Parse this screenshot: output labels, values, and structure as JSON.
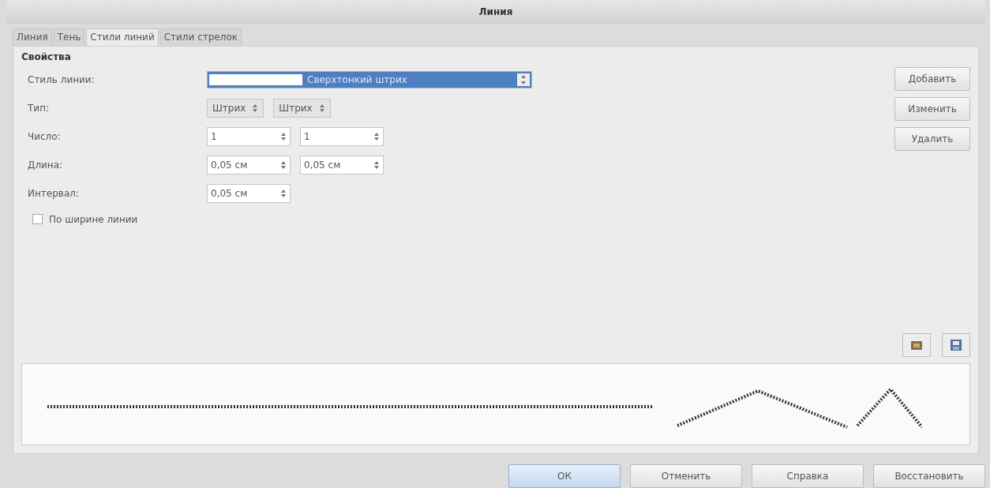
{
  "window": {
    "title": "Линия"
  },
  "tabs": [
    {
      "label": "Линия",
      "selected": false
    },
    {
      "label": "Тень",
      "selected": false
    },
    {
      "label": "Стили линий",
      "selected": true
    },
    {
      "label": "Стили стрелок",
      "selected": false
    }
  ],
  "section_title": "Свойства",
  "fields": [
    {
      "kind": "style",
      "label": "Стиль линии:",
      "values": [
        "Сверхтонкий штрих"
      ]
    },
    {
      "kind": "select",
      "label": "Тип:",
      "values": [
        "Штрих",
        "Штрих"
      ]
    },
    {
      "kind": "spin",
      "label": "Число:",
      "values": [
        "1",
        "1"
      ]
    },
    {
      "kind": "spin",
      "label": "Длина:",
      "values": [
        "0,05 см",
        "0,05 см"
      ]
    },
    {
      "kind": "spin",
      "label": "Интервал:",
      "values": [
        "0,05 см"
      ]
    }
  ],
  "checkbox": {
    "label": "По ширине линии",
    "checked": false
  },
  "side_buttons": [
    "Добавить",
    "Изменить",
    "Удалить"
  ],
  "dialog_buttons": [
    {
      "label": "ОК",
      "default": true
    },
    {
      "label": "Отменить",
      "default": false
    },
    {
      "label": "Справка",
      "default": false
    },
    {
      "label": "Восстановить",
      "default": false
    }
  ]
}
